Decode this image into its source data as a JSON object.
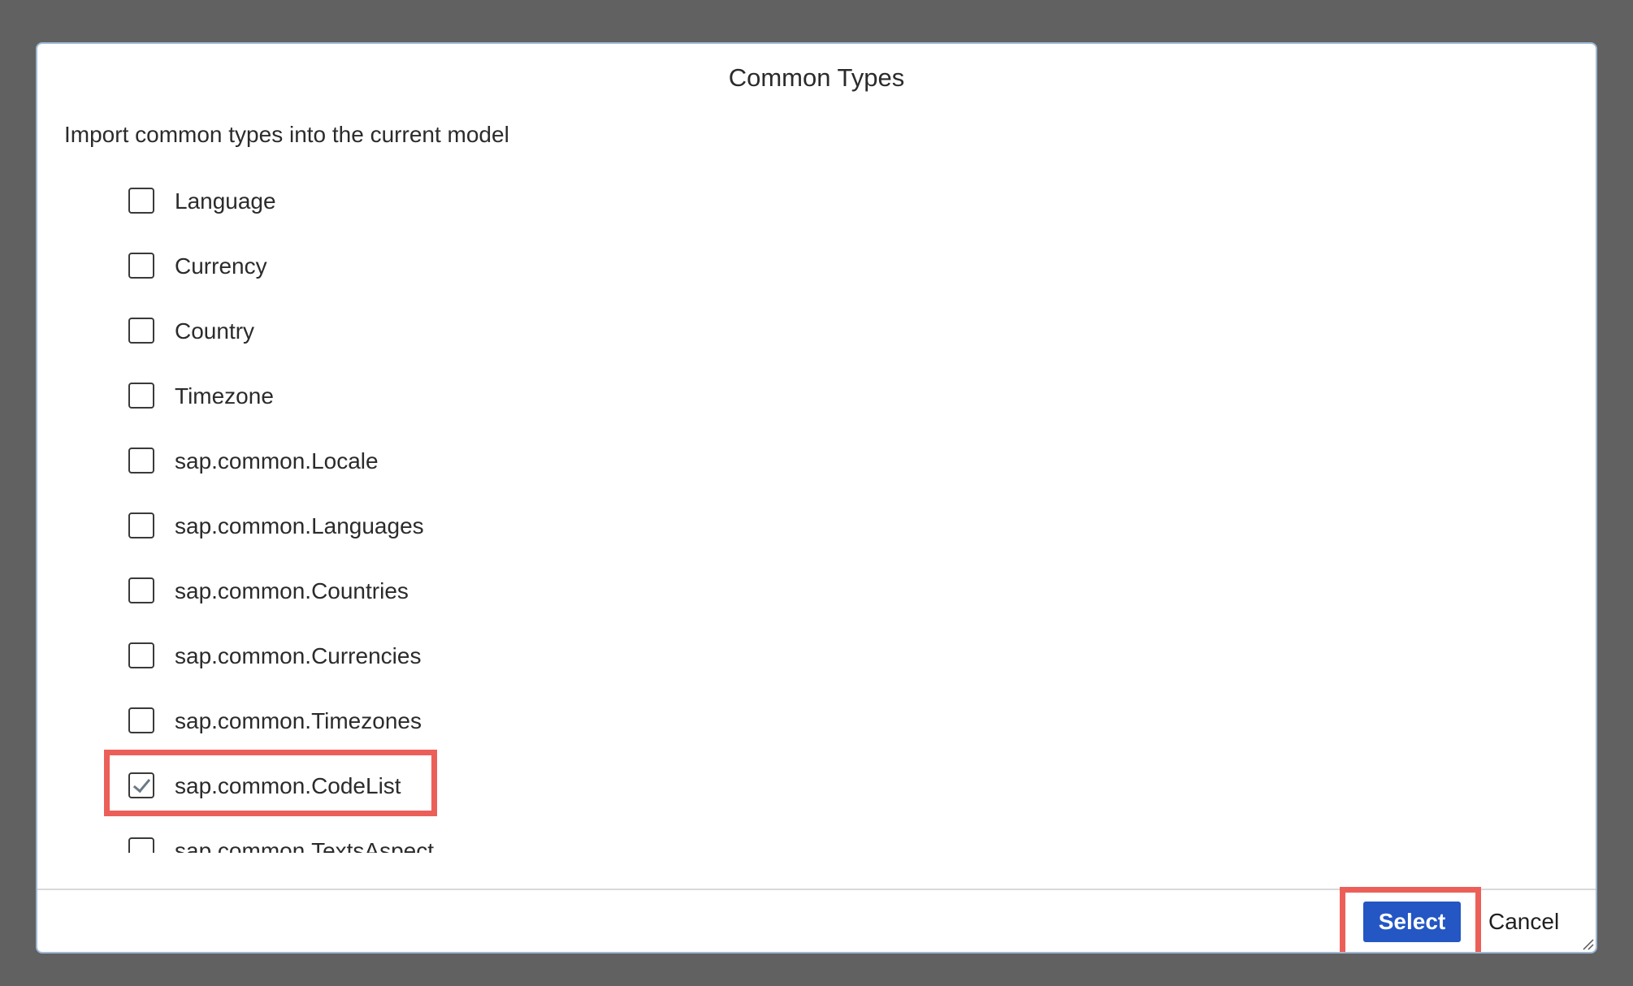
{
  "dialog": {
    "title": "Common Types",
    "description": "Import common types into the current model"
  },
  "items": [
    {
      "label": "Language",
      "checked": false
    },
    {
      "label": "Currency",
      "checked": false
    },
    {
      "label": "Country",
      "checked": false
    },
    {
      "label": "Timezone",
      "checked": false
    },
    {
      "label": "sap.common.Locale",
      "checked": false
    },
    {
      "label": "sap.common.Languages",
      "checked": false
    },
    {
      "label": "sap.common.Countries",
      "checked": false
    },
    {
      "label": "sap.common.Currencies",
      "checked": false
    },
    {
      "label": "sap.common.Timezones",
      "checked": false
    },
    {
      "label": "sap.common.CodeList",
      "checked": true
    },
    {
      "label": "sap.common.TextsAspect",
      "checked": false
    }
  ],
  "footer": {
    "select_label": "Select",
    "cancel_label": "Cancel"
  },
  "colors": {
    "primary_button": "#2456c4",
    "highlight": "#ec5f59",
    "backdrop": "#616161"
  }
}
